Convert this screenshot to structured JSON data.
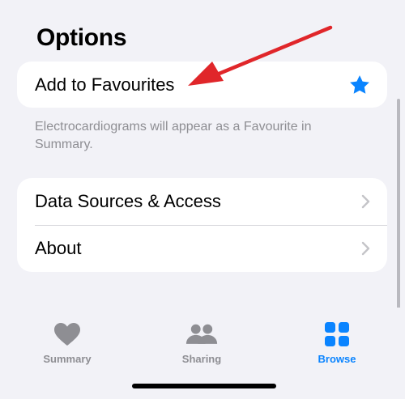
{
  "options": {
    "title": "Options",
    "favourites": {
      "label": "Add to Favourites",
      "icon": "star-icon",
      "note": "Electrocardiograms will appear as a Favourite in Summary."
    },
    "rows": [
      {
        "label": "Data Sources & Access",
        "icon": "chevron-right-icon"
      },
      {
        "label": "About",
        "icon": "chevron-right-icon"
      }
    ]
  },
  "tabbar": {
    "tabs": [
      {
        "label": "Summary",
        "icon": "heart-icon",
        "selected": false
      },
      {
        "label": "Sharing",
        "icon": "people-icon",
        "selected": false
      },
      {
        "label": "Browse",
        "icon": "grid-icon",
        "selected": true
      }
    ]
  },
  "colors": {
    "accent": "#0A84FF",
    "annotation_arrow": "#E0262A",
    "inactive": "#8E8E93",
    "background": "#F2F2F7"
  }
}
